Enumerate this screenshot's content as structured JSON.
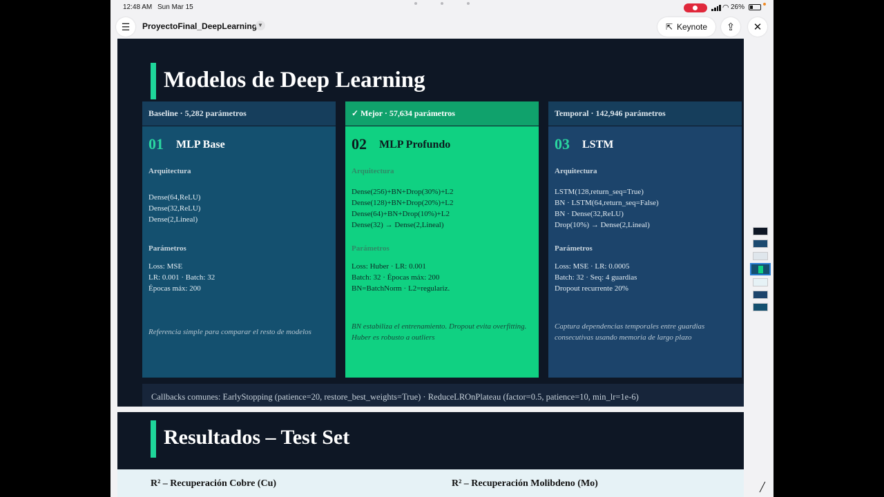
{
  "status": {
    "time": "12:48 AM",
    "date": "Sun Mar 15",
    "battery": "26%"
  },
  "toolbar": {
    "doc_title": "ProyectoFinal_DeepLearning",
    "keynote_label": "Keynote"
  },
  "slide1": {
    "title": "Modelos de Deep Learning",
    "columns": [
      {
        "header": "Baseline · 5,282 parámetros",
        "number": "01",
        "name": "MLP Base",
        "arch_label": "Arquitectura",
        "arch": [
          "Dense(64,ReLU)",
          "Dense(32,ReLU)",
          "Dense(2,Lineal)"
        ],
        "params_label": "Parámetros",
        "params": [
          "Loss: MSE",
          "LR: 0.001 · Batch: 32",
          "Épocas máx: 200"
        ],
        "note": "Referencia simple para comparar el resto de modelos"
      },
      {
        "header": "✓ Mejor · 57,634 parámetros",
        "number": "02",
        "name": "MLP Profundo",
        "arch_label": "Arquitectura",
        "arch": [
          "Dense(256)+BN+Drop(30%)+L2",
          "Dense(128)+BN+Drop(20%)+L2",
          "Dense(64)+BN+Drop(10%)+L2",
          "Dense(32) → Dense(2,Lineal)"
        ],
        "params_label": "Parámetros",
        "params": [
          "Loss: Huber · LR: 0.001",
          "Batch: 32 · Épocas máx: 200",
          "BN=BatchNorm · L2=regulariz."
        ],
        "note": "BN estabiliza el entrenamiento. Dropout evita overfitting. Huber es robusto a outliers"
      },
      {
        "header": "Temporal · 142,946 parámetros",
        "number": "03",
        "name": "LSTM",
        "arch_label": "Arquitectura",
        "arch": [
          "LSTM(128,return_seq=True)",
          "BN · LSTM(64,return_seq=False)",
          "BN · Dense(32,ReLU)",
          "Drop(10%) → Dense(2,Lineal)"
        ],
        "params_label": "Parámetros",
        "params": [
          "Loss: MSE · LR: 0.0005",
          "Batch: 32 · Seq: 4 guardias",
          "Dropout recurrente 20%"
        ],
        "note": "Captura dependencias temporales entre guardias consecutivas usando memoria de largo plazo"
      }
    ],
    "callbacks": "Callbacks comunes: EarlyStopping (patience=20, restore_best_weights=True) · ReduceLROnPlateau (factor=0.5, patience=10, min_lr=1e-6)"
  },
  "slide2": {
    "title": "Resultados – Test Set",
    "left_heading": "R² – Recuperación Cobre (Cu)",
    "right_heading": "R² – Recuperación Molibdeno (Mo)"
  },
  "colors": {
    "slide_bg": "#0e1725",
    "accent_green": "#1ed69a",
    "card_blue_1": "#14506f",
    "card_green": "#10d182",
    "card_blue_3": "#1c446b"
  }
}
